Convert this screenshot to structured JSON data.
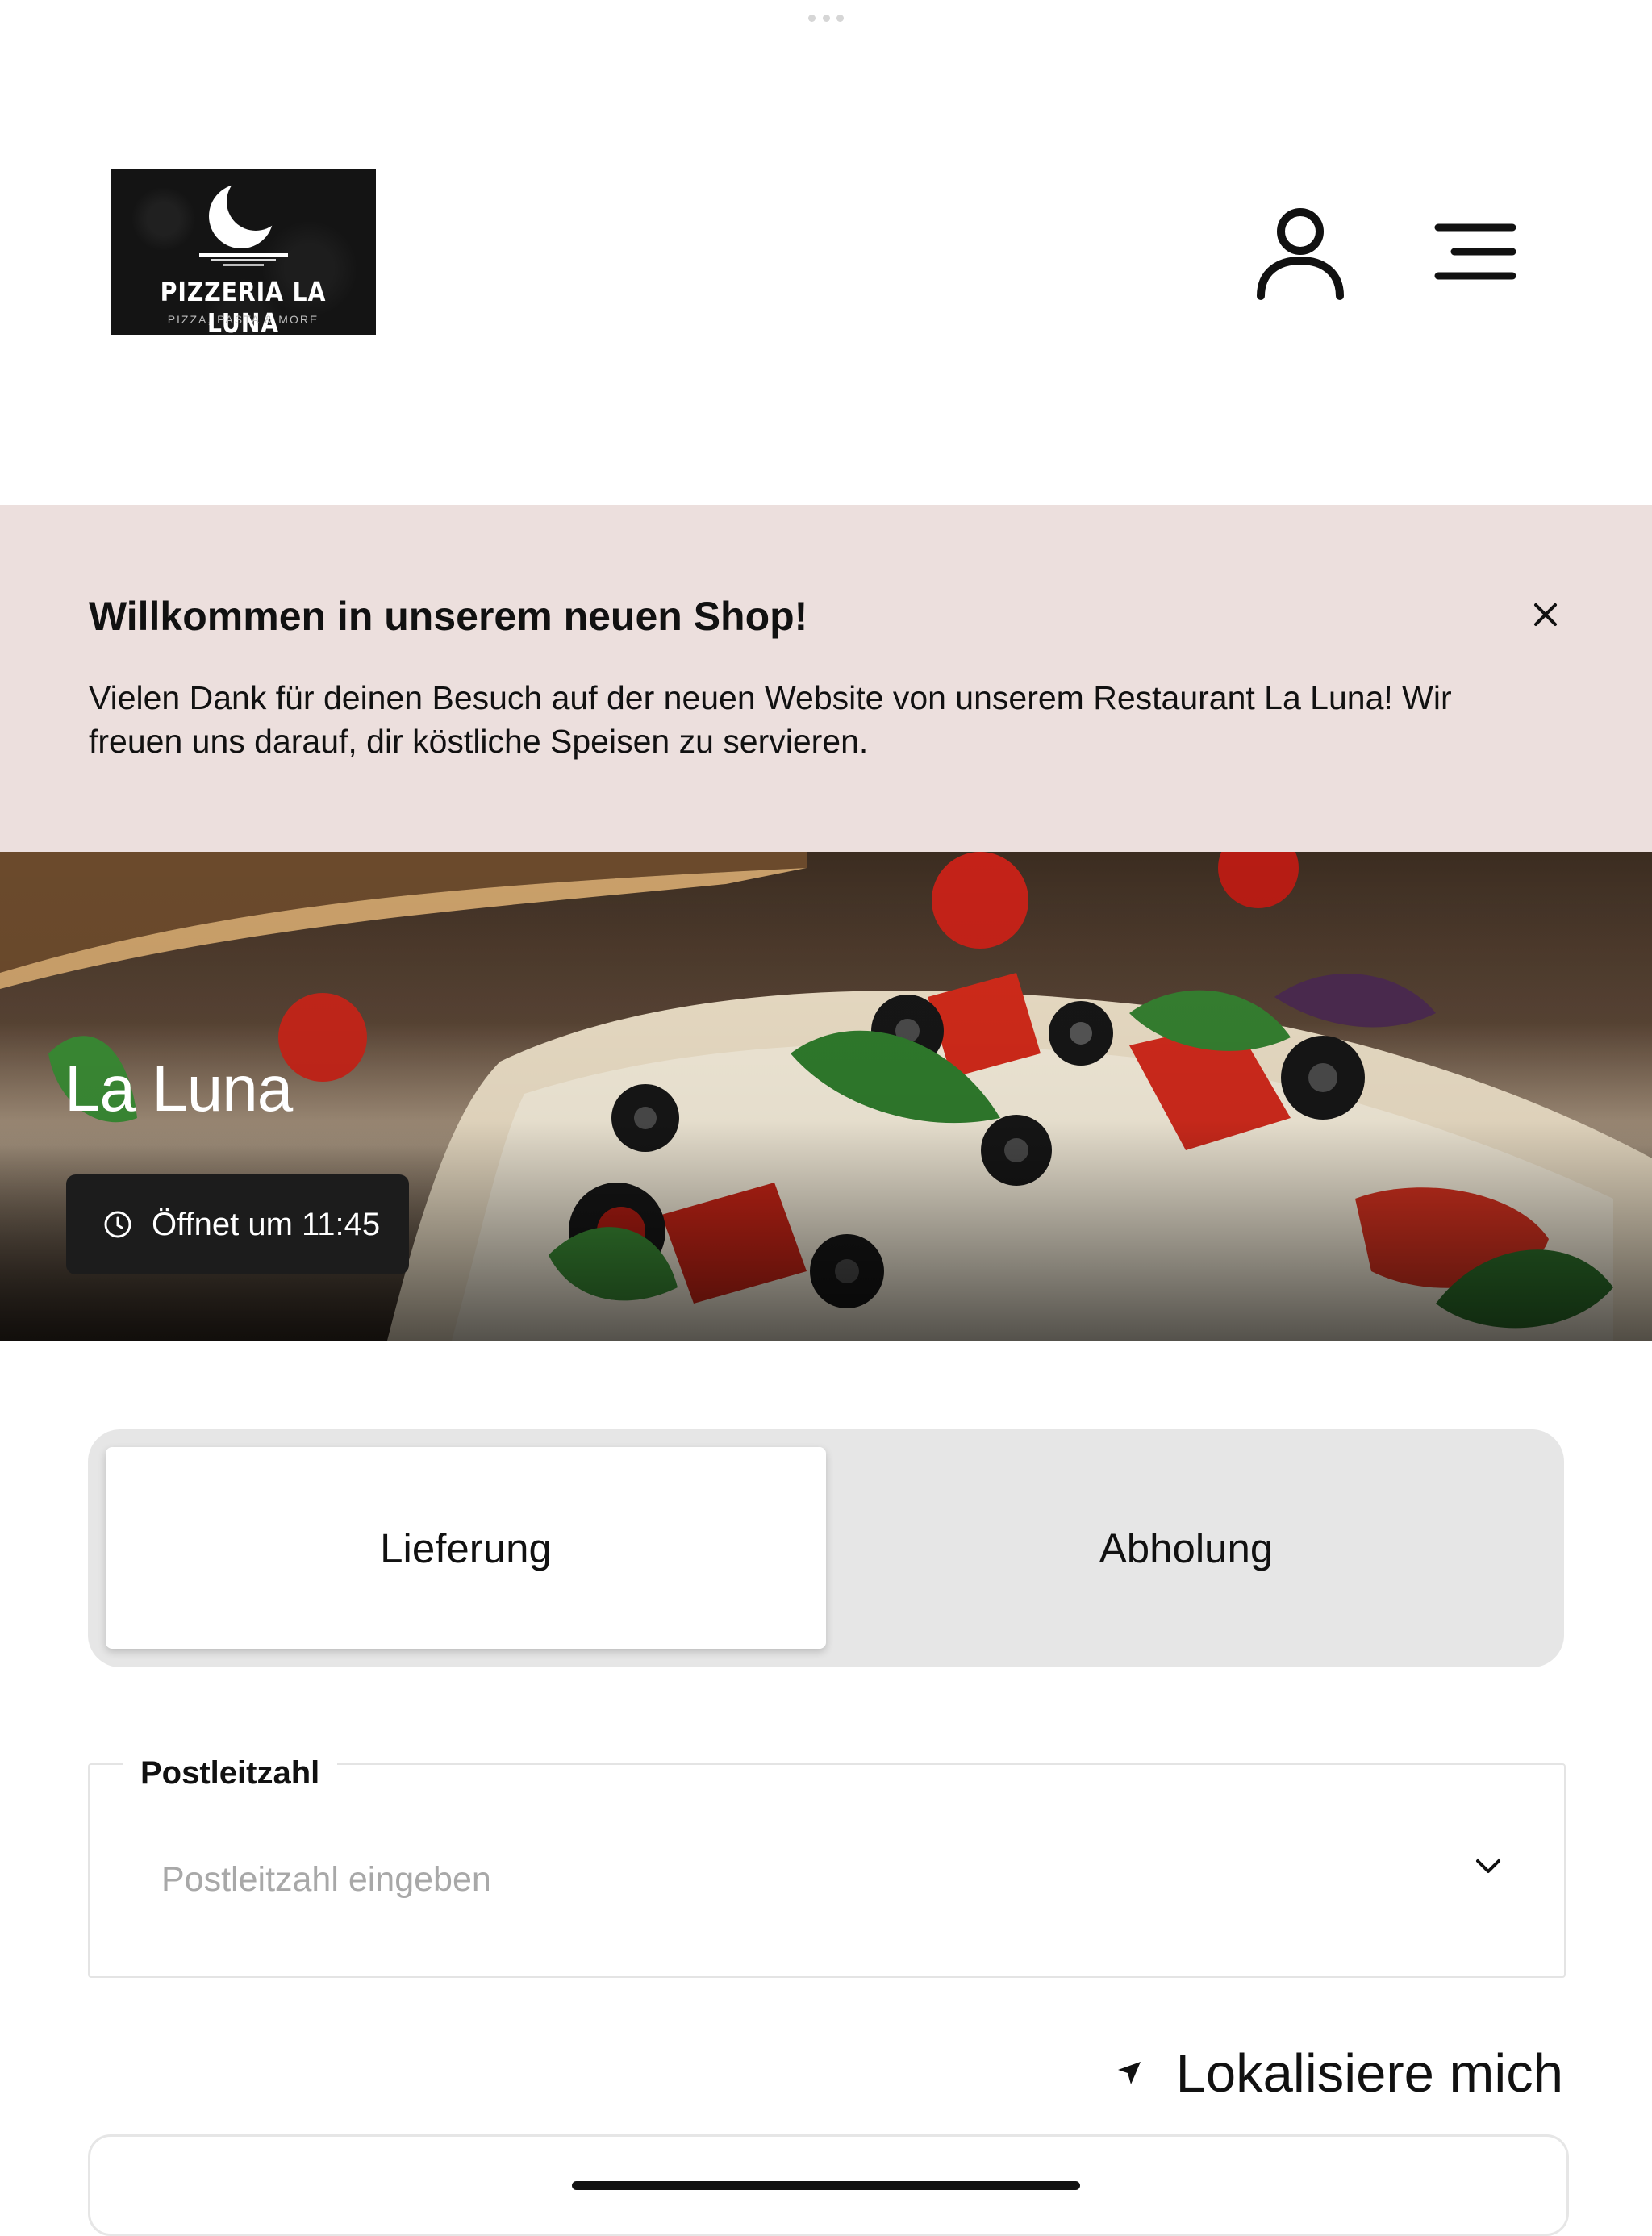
{
  "header": {
    "logo": {
      "title": "PIZZERIA LA LUNA",
      "subtitle": "PIZZA, PASTA & MORE"
    },
    "icons": {
      "user": "user-icon",
      "menu": "menu-icon"
    }
  },
  "banner": {
    "title": "Willkommen in unserem neuen Shop!",
    "text": "Vielen Dank für deinen Besuch auf der neuen Website von unserem Restaurant La Luna! Wir freuen uns darauf, dir köstliche Speisen zu servieren.",
    "close_icon": "close-icon",
    "background": "#ecdfdd"
  },
  "hero": {
    "restaurant_name": "La Luna",
    "opening_status": "Öffnet um 11:45",
    "status_icon": "clock-icon"
  },
  "order_mode": {
    "options": [
      {
        "label": "Lieferung",
        "selected": true
      },
      {
        "label": "Abholung",
        "selected": false
      }
    ]
  },
  "postal_code": {
    "label": "Postleitzahl",
    "placeholder": "Postleitzahl eingeben",
    "value": "",
    "dropdown_icon": "chevron-down-icon"
  },
  "locate": {
    "label": "Lokalisiere mich",
    "icon": "location-arrow-icon"
  },
  "colors": {
    "accent_dark": "#111111",
    "segment_bg": "#e6e6e6",
    "badge_bg": "#1c1c1c"
  }
}
